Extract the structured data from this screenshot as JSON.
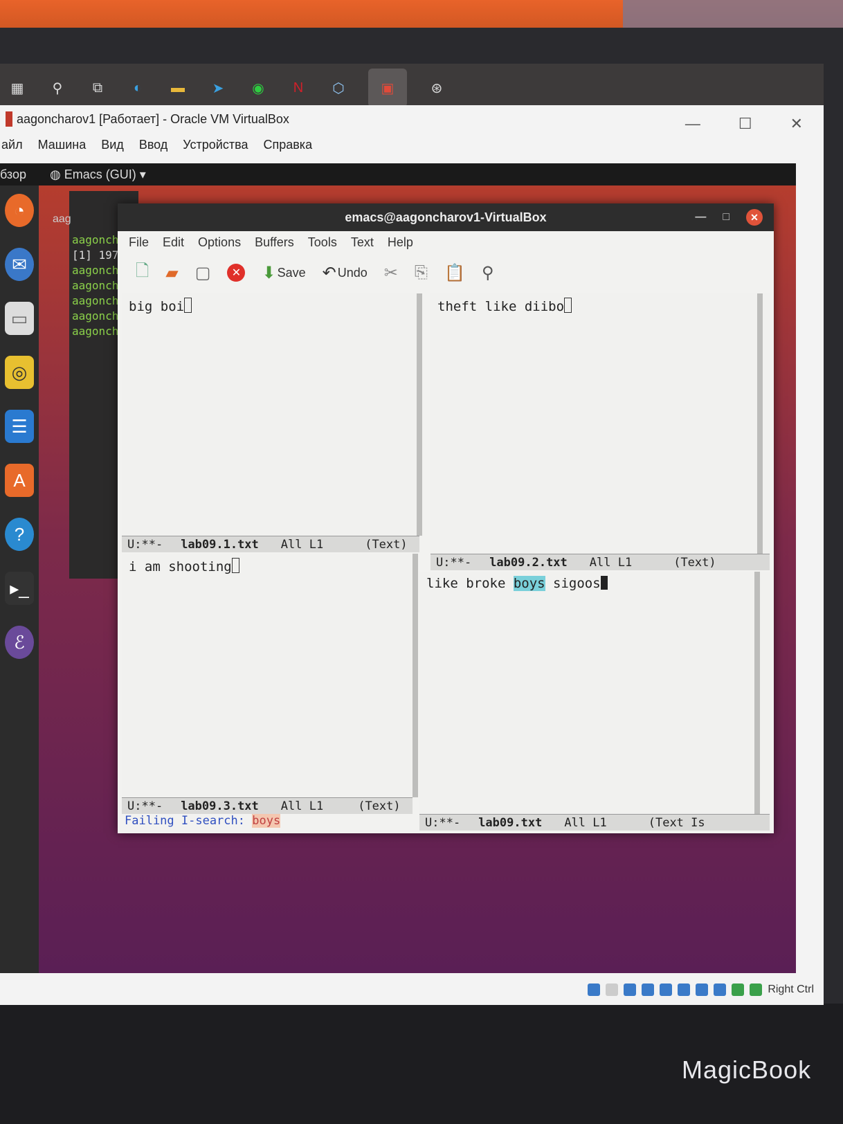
{
  "vbox": {
    "title": "aagoncharov1 [Работает] - Oracle VM VirtualBox",
    "menu": [
      "айл",
      "Машина",
      "Вид",
      "Ввод",
      "Устройства",
      "Справка"
    ],
    "host_key": "Right Ctrl"
  },
  "gnome": {
    "activities": "бзор",
    "app_menu": "Emacs (GUI)"
  },
  "terminal": {
    "title": "aag",
    "lines": [
      "aagonch",
      "[1] 197",
      "aagonch",
      "aagonch",
      "aagonch",
      "aagonch",
      "aagonch"
    ]
  },
  "emacs": {
    "title": "emacs@aagoncharov1-VirtualBox",
    "menu": [
      "File",
      "Edit",
      "Options",
      "Buffers",
      "Tools",
      "Text",
      "Help"
    ],
    "toolbar": {
      "save": "Save",
      "undo": "Undo"
    },
    "windows": [
      {
        "text": "big boi",
        "status": "U:**-",
        "buffer": "lab09.1.txt",
        "position": "All L1",
        "mode": "(Text)"
      },
      {
        "text": "theft like diibo",
        "status": "U:**-",
        "buffer": "lab09.2.txt",
        "position": "All L1",
        "mode": "(Text)"
      },
      {
        "text": "i am shooting",
        "status": "U:**-",
        "buffer": "lab09.3.txt",
        "position": "All L1",
        "mode": "(Text)"
      },
      {
        "text_before": "like broke ",
        "highlight": "boys",
        "text_after": " sigoos",
        "status": "U:**-",
        "buffer": "lab09.txt",
        "position": "All L1",
        "mode": "(Text Is"
      }
    ],
    "minibuffer": {
      "prompt": "Failing I-search: ",
      "query": "boys"
    }
  },
  "laptop": {
    "brand": "MagicBook"
  }
}
